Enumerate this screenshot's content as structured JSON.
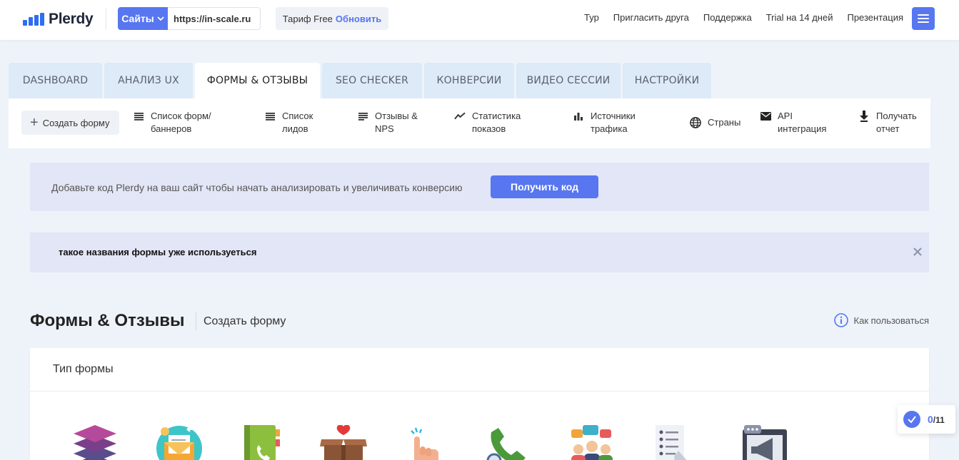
{
  "header": {
    "logo_text": "Plerdy",
    "site_select_label": "Сайты",
    "site_url": "https://in-scale.ru",
    "tariff_label": "Тариф Free",
    "tariff_upgrade": "Обновить",
    "nav": [
      "Тур",
      "Пригласить друга",
      "Поддержка",
      "Trial на 14 дней",
      "Презентация"
    ]
  },
  "tabs": [
    {
      "label": "DASHBOARD",
      "active": false
    },
    {
      "label": "АНАЛИЗ UX",
      "active": false
    },
    {
      "label": "ФОРМЫ & ОТЗЫВЫ",
      "active": true
    },
    {
      "label": "SEO CHECKER",
      "active": false
    },
    {
      "label": "КОНВЕРСИИ",
      "active": false
    },
    {
      "label": "ВИДЕО СЕССИИ",
      "active": false
    },
    {
      "label": "НАСТРОЙКИ",
      "active": false
    }
  ],
  "subbar": {
    "create_label": "Создать форму",
    "items": [
      {
        "icon": "list-icon",
        "label": "Список форм/\nбаннеров"
      },
      {
        "icon": "list-icon",
        "label": "Список\nлидов"
      },
      {
        "icon": "lines-icon",
        "label": "Отзывы &\nNPS"
      },
      {
        "icon": "trend-icon",
        "label": "Статистика\nпоказов"
      },
      {
        "icon": "bar-chart-icon",
        "label": "Источники\nтрафика"
      },
      {
        "icon": "globe-icon",
        "label": "Страны"
      },
      {
        "icon": "mail-icon",
        "label": "API\nинтеграция"
      },
      {
        "icon": "download-icon",
        "label": "Получать\nотчет"
      }
    ]
  },
  "banner_install": {
    "text": "Добавьте код Plerdy на ваш сайт чтобы начать анализировать и увеличивать конверсию",
    "button": "Получить код"
  },
  "banner_error": {
    "text": "такое названия формы уже используеться"
  },
  "section": {
    "title": "Формы & Отзывы",
    "subtitle": "Создать форму",
    "howto": "Как пользоваться"
  },
  "card": {
    "title": "Тип формы",
    "types": [
      "layers-icon",
      "envelope-icon",
      "phonebook-icon",
      "gift-box-icon",
      "tap-finger-icon",
      "phone-search-icon",
      "team-chat-icon",
      "checklist-icon",
      "megaphone-screen-icon"
    ]
  },
  "counter": {
    "done": "0",
    "total": "/11"
  },
  "colors": {
    "accent": "#5776f0",
    "banner_bg": "#e2e6f6",
    "tab_bg": "#ddeaf7"
  }
}
